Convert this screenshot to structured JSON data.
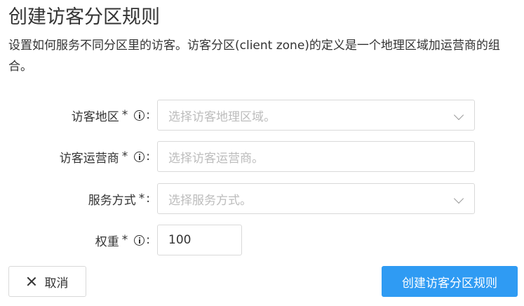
{
  "header": {
    "title": "创建访客分区规则",
    "description": "设置如何服务不同分区里的访客。访客分区(client zone)的定义是一个地理区域加运营商的组合。"
  },
  "form": {
    "region": {
      "label": "访客地区",
      "required_mark": "*",
      "colon": ":",
      "placeholder": "选择访客地理区域。"
    },
    "isp": {
      "label": "访客运营商",
      "required_mark": "*",
      "colon": ":",
      "placeholder": "选择访客运营商。"
    },
    "service": {
      "label": "服务方式",
      "required_mark": "*",
      "colon": ":",
      "placeholder": "选择服务方式。"
    },
    "weight": {
      "label": "权重",
      "required_mark": "*",
      "colon": ":",
      "value": "100"
    }
  },
  "actions": {
    "cancel_label": "取消",
    "submit_label": "创建访客分区规则"
  },
  "colors": {
    "primary": "#2f9bf3",
    "border": "#d9d9d9",
    "placeholder": "#bcbcbc",
    "text": "#333333"
  },
  "icons": {
    "info": "info-circle-icon",
    "dropdown": "chevron-down-icon",
    "cancel": "close-icon"
  }
}
